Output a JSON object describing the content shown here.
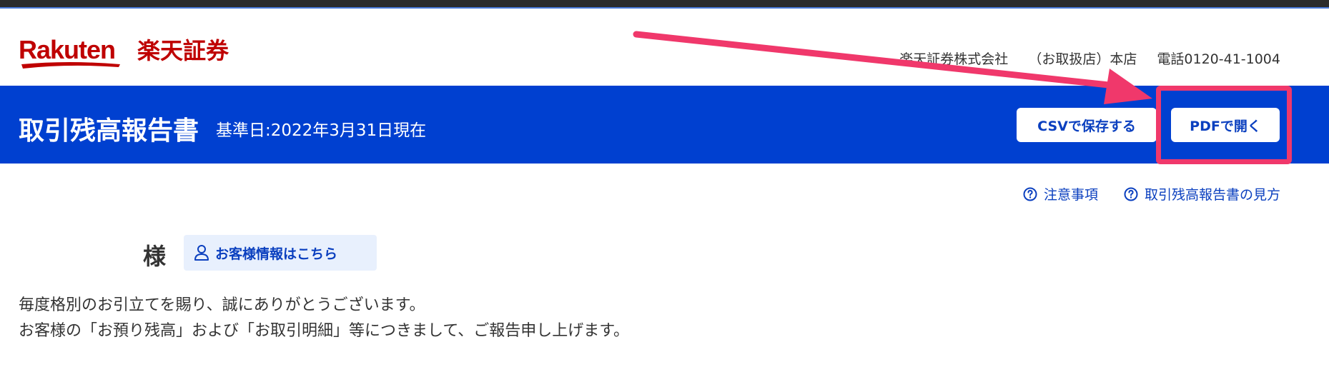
{
  "header": {
    "logo_text": "Rakuten 楽天証券",
    "company": "楽天証券株式会社",
    "branch": "（お取扱店）本店",
    "phone": "電話0120-41-1004"
  },
  "banner": {
    "title": "取引残高報告書",
    "date": "基準日:2022年3月31日現在",
    "csv_button": "CSVで保存する",
    "pdf_button": "PDFで開く"
  },
  "help": {
    "notes": "注意事項",
    "guide": "取引残高報告書の見方"
  },
  "customer": {
    "honorific": "様",
    "info_button": "お客様情報はこちら"
  },
  "intro": {
    "line1": "毎度格別のお引立てを賜り、誠にありがとうございます。",
    "line2": "お客様の「お預り残高」および「お取引明細」等につきまして、ご報告申し上げます。"
  },
  "colors": {
    "brand_red": "#bf0000",
    "banner_blue": "#0040d0",
    "link_blue": "#0a3fbf",
    "annotation_pink": "#f0386b"
  }
}
